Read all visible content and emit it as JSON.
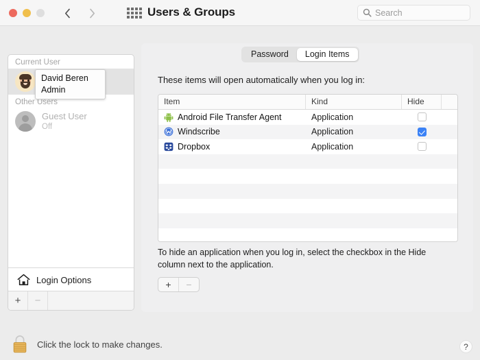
{
  "window": {
    "title": "Users & Groups",
    "traffic_lights": [
      "close",
      "minimize",
      "zoom"
    ],
    "nav_back_icon": "chevron-left-icon",
    "nav_forward_icon": "chevron-right-icon",
    "grid_icon": "grid-apps-icon"
  },
  "search": {
    "placeholder": "Search",
    "icon": "search-icon",
    "value": ""
  },
  "sidebar": {
    "current_user_group": "Current User",
    "other_users_group": "Other Users",
    "current_user": {
      "name": "David Beren",
      "role": "Admin",
      "avatar": "memoji-avatar",
      "selected": true
    },
    "other_users": [
      {
        "name": "Guest User",
        "status": "Off",
        "avatar": "guest-silhouette-avatar"
      }
    ],
    "tooltip": {
      "name": "David Beren",
      "role": "Admin"
    },
    "login_options": {
      "label": "Login Options",
      "icon": "home-icon"
    },
    "footer": {
      "add_label": "+",
      "remove_label": "−"
    }
  },
  "content": {
    "tabs": [
      {
        "label": "Password",
        "active": false
      },
      {
        "label": "Login Items",
        "active": true
      }
    ],
    "intro": "These items will open automatically when you log in:",
    "table": {
      "columns": [
        "Item",
        "Kind",
        "Hide"
      ],
      "rows": [
        {
          "item": "Android File Transfer Agent",
          "kind": "Application",
          "hide": false,
          "icon": "android-robot-icon"
        },
        {
          "item": "Windscribe",
          "kind": "Application",
          "hide": true,
          "icon": "windscribe-icon"
        },
        {
          "item": "Dropbox",
          "kind": "Application",
          "hide": false,
          "icon": "dropbox-icon"
        }
      ],
      "empty_row_count": 6
    },
    "helper_text": "To hide an application when you log in, select the checkbox in the Hide column next to the application.",
    "add_remove": {
      "add_label": "+",
      "remove_label": "−"
    }
  },
  "footer": {
    "lock_label": "Click the lock to make changes.",
    "lock_icon": "closed-padlock-icon",
    "help_label": "?"
  },
  "colors": {
    "accent": "#3b82f6",
    "close": "#ed6a5e",
    "minimize": "#f0bf4c",
    "zoom": "#dedede",
    "window_bg": "#ececec",
    "panel_bg": "#efeff0",
    "lock_gold": "#e2b257"
  }
}
